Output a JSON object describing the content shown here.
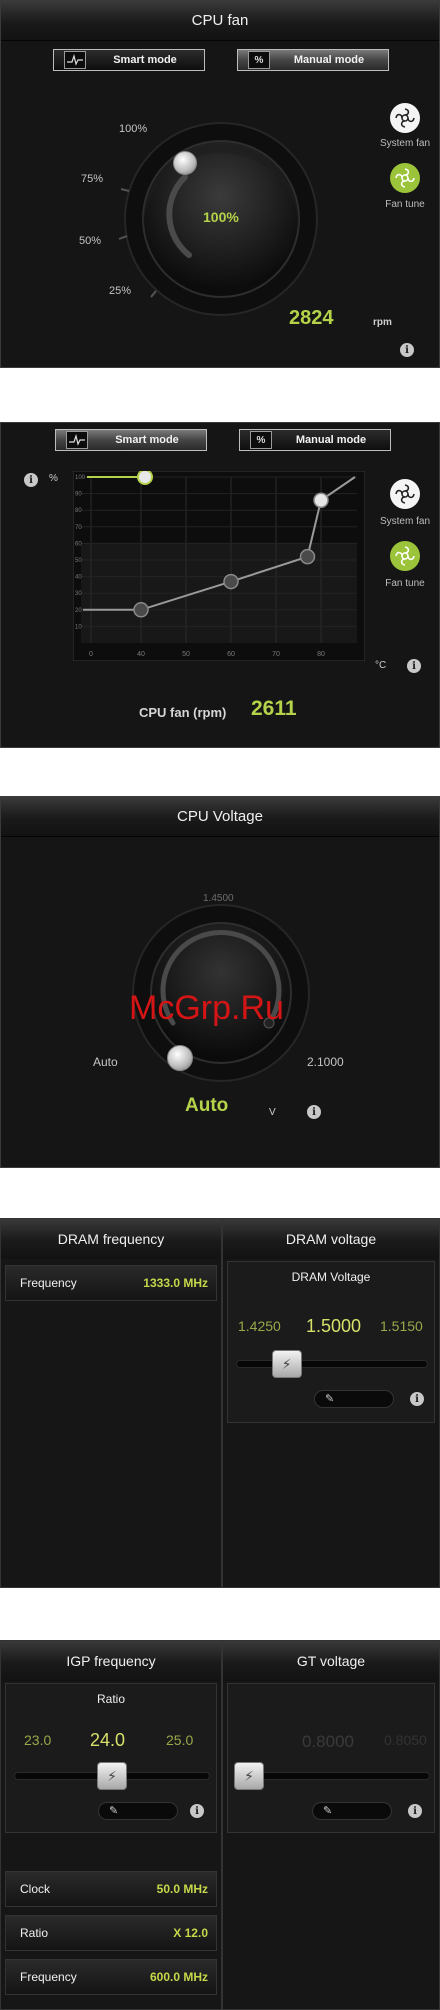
{
  "cpu_fan_manual": {
    "title": "CPU fan",
    "smart_mode": "Smart mode",
    "manual_mode": "Manual mode",
    "dial_labels": [
      "100%",
      "75%",
      "50%",
      "25%"
    ],
    "dial_value": "100%",
    "rpm_value": "2824",
    "rpm_unit": "rpm",
    "system_fan": "System fan",
    "fan_tune": "Fan tune",
    "dial_level_percent": 100
  },
  "cpu_fan_smart": {
    "smart_mode": "Smart mode",
    "manual_mode": "Manual mode",
    "percent_label": "%",
    "celsius_label": "°C",
    "y_ticks": [
      "100",
      "90",
      "80",
      "70",
      "60",
      "50",
      "40",
      "30",
      "20",
      "10"
    ],
    "x_ticks": [
      "0",
      "40",
      "50",
      "60",
      "70",
      "80"
    ],
    "rpm_label": "CPU fan (rpm)",
    "rpm_value": "2611",
    "system_fan": "System fan",
    "fan_tune": "Fan tune",
    "curve_points": [
      {
        "temp": 40,
        "percent": 20
      },
      {
        "temp": 60,
        "percent": 37
      },
      {
        "temp": 77,
        "percent": 52
      },
      {
        "temp": 80,
        "percent": 86
      }
    ]
  },
  "cpu_voltage": {
    "title": "CPU Voltage",
    "top_value": "1.4500",
    "left_value": "Auto",
    "right_value": "2.1000",
    "center_value": "Auto",
    "unit": "V",
    "watermark": "McGrp.Ru"
  },
  "dram": {
    "freq_title": "DRAM frequency",
    "volt_title": "DRAM voltage",
    "frequency_label": "Frequency",
    "frequency_value": "1333.0 MHz",
    "voltage_subtitle": "DRAM Voltage",
    "voltage_values": [
      "1.4250",
      "1.5000",
      "1.5150"
    ],
    "slider_level_fraction": 0.22
  },
  "igp": {
    "freq_title": "IGP frequency",
    "volt_title": "GT voltage",
    "ratio_subtitle": "Ratio",
    "ratio_values": [
      "23.0",
      "24.0",
      "25.0"
    ],
    "gt_values": [
      "0.8000",
      "0.8050"
    ],
    "rows": [
      {
        "label": "Clock",
        "value": "50.0 MHz"
      },
      {
        "label": "Ratio",
        "value": "X 12.0"
      },
      {
        "label": "Frequency",
        "value": "600.0 MHz"
      }
    ],
    "ratio_slider_fraction": 0.5,
    "gt_slider_fraction": 0.0
  },
  "colors": {
    "accent": "#b5d34a",
    "panel": "#151515",
    "fan_tune": "#9cc43a"
  }
}
